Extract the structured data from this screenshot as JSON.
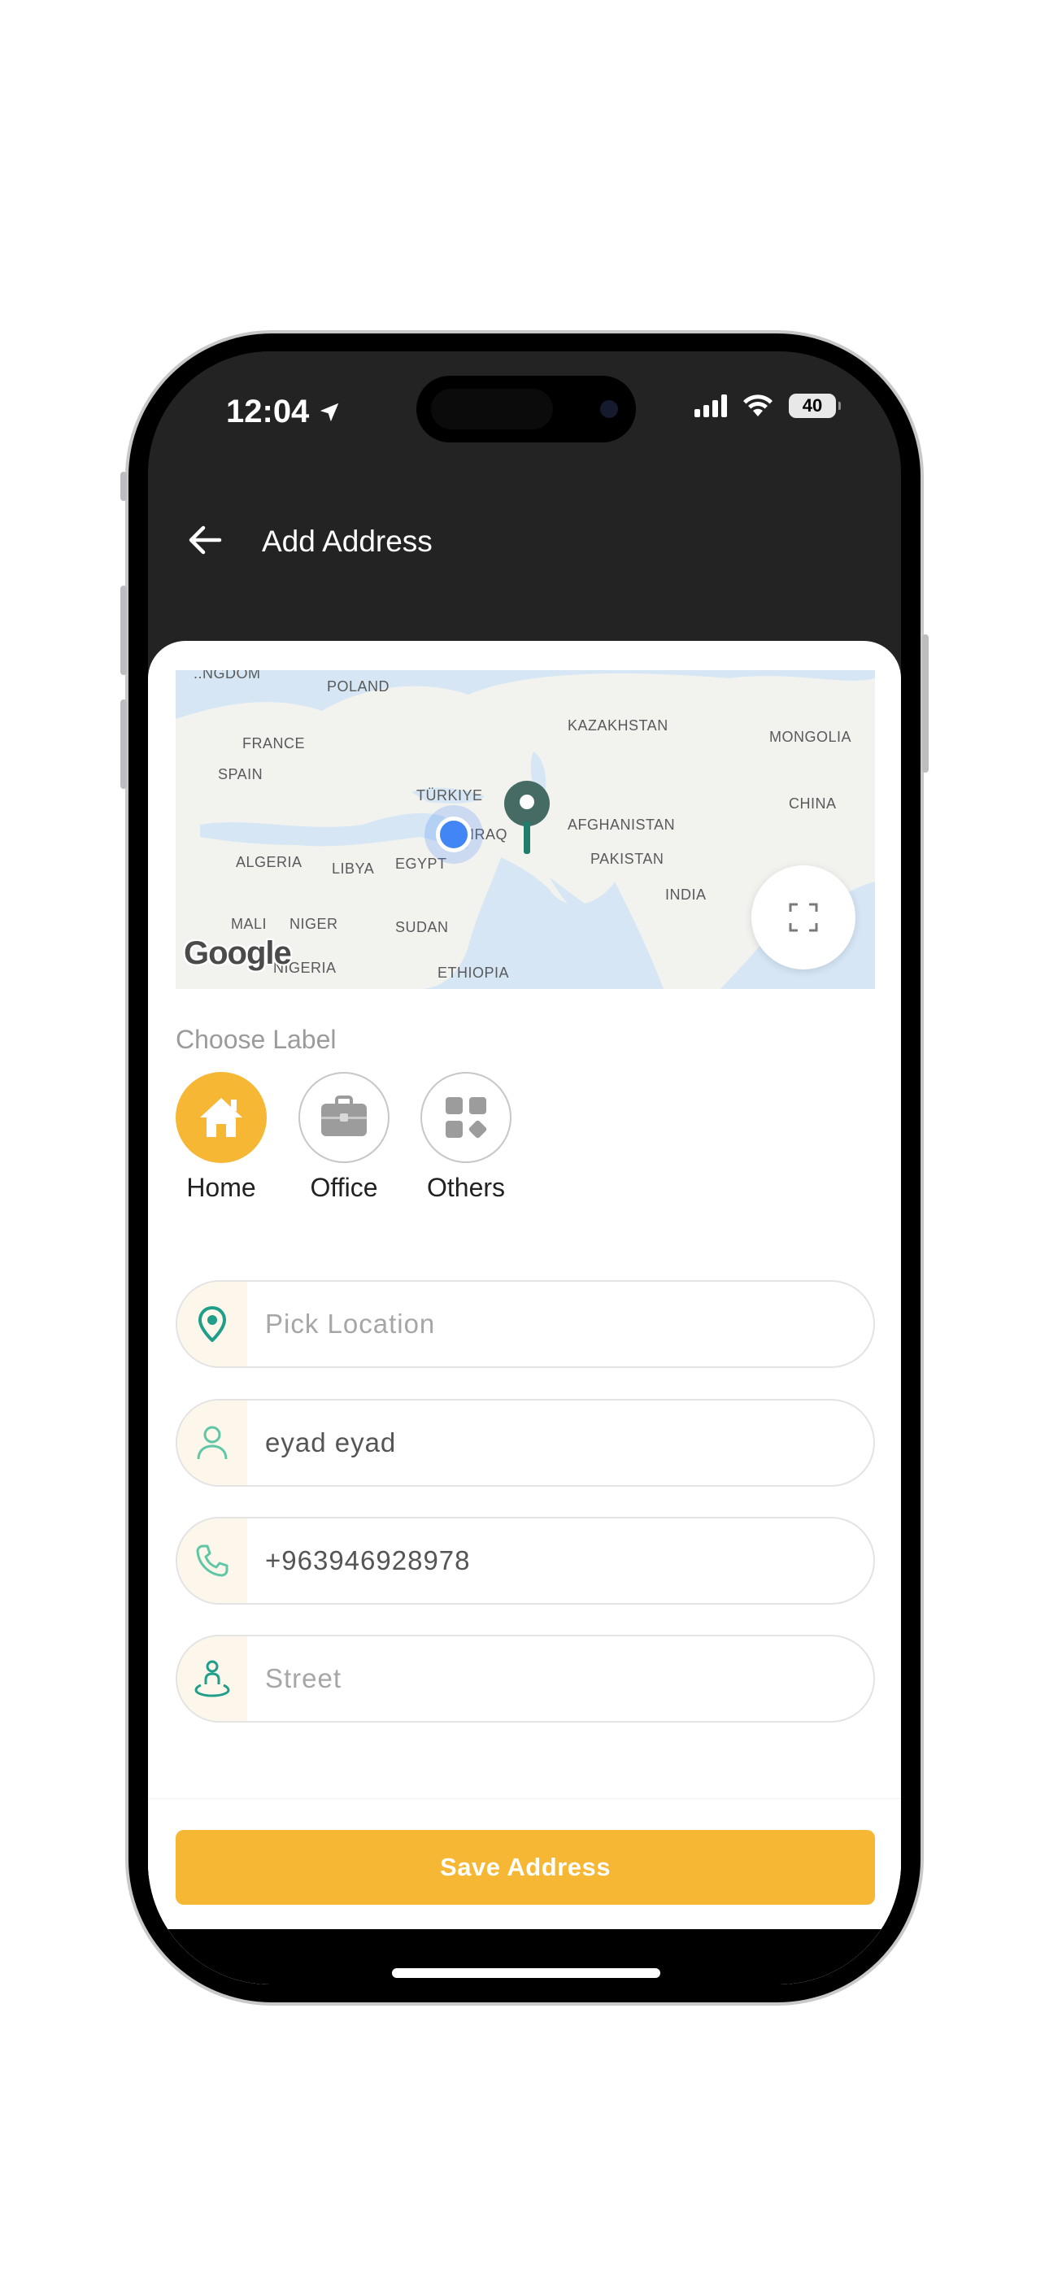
{
  "status_bar": {
    "time": "12:04",
    "battery": "40"
  },
  "header": {
    "title": "Add Address",
    "back_icon": "arrow-left-icon"
  },
  "map": {
    "labels": [
      "POLAND",
      "FRANCE",
      "SPAIN",
      "KAZAKHSTAN",
      "MONGOLIA",
      "TÜRKIYE",
      "CHINA",
      "IRAQ",
      "AFGHANISTAN",
      "ALGERIA",
      "LIBYA",
      "EGYPT",
      "PAKISTAN",
      "INDIA",
      "MALI",
      "NIGER",
      "SUDAN",
      "NIGERIA",
      "ETHIOPIA"
    ],
    "logo": "Google",
    "fullscreen_icon": "fullscreen-icon"
  },
  "choose_label": {
    "title": "Choose Label",
    "options": [
      {
        "label": "Home",
        "icon": "home-icon",
        "selected": true
      },
      {
        "label": "Office",
        "icon": "briefcase-icon",
        "selected": false
      },
      {
        "label": "Others",
        "icon": "grid-icon",
        "selected": false
      }
    ]
  },
  "fields": {
    "location": {
      "placeholder": "Pick Location",
      "value": "",
      "icon": "location-pin-icon"
    },
    "name": {
      "placeholder": "",
      "value": "eyad eyad",
      "icon": "person-icon"
    },
    "phone": {
      "placeholder": "",
      "value": "+963946928978",
      "icon": "phone-icon"
    },
    "street": {
      "placeholder": "Street",
      "value": "",
      "icon": "street-pin-icon"
    }
  },
  "save_button": {
    "label": "Save Address"
  },
  "colors": {
    "accent": "#f5b734",
    "header_bg": "#232323",
    "teal": "#1f9e8a"
  }
}
